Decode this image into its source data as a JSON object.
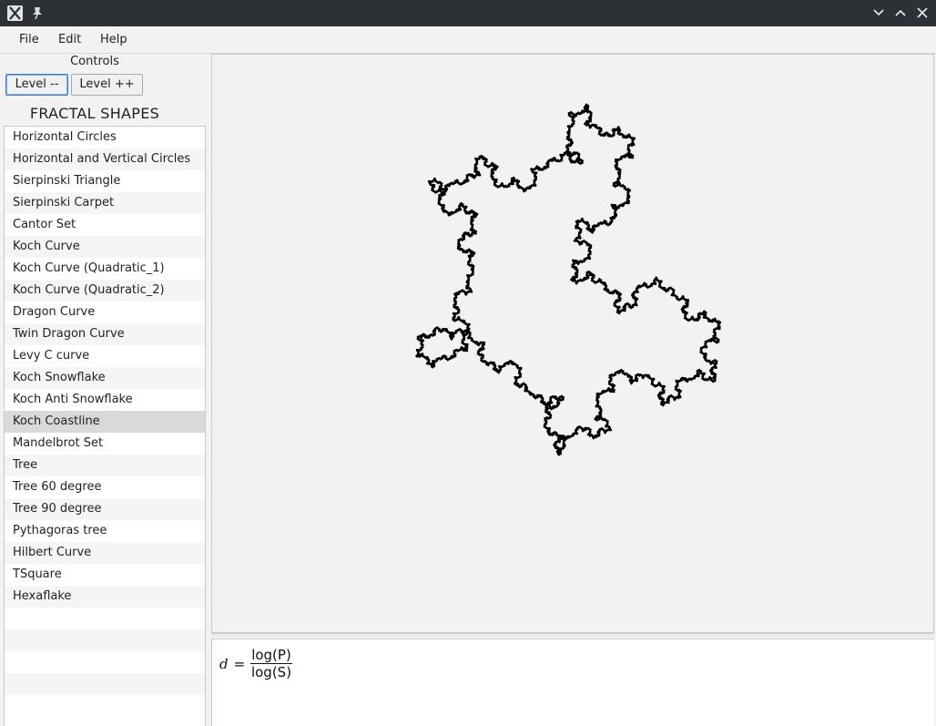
{
  "menu": {
    "file": "File",
    "edit": "Edit",
    "help": "Help"
  },
  "controls": {
    "label": "Controls",
    "level_down": "Level --",
    "level_up": "Level ++",
    "shapes_title": "FRACTAL SHAPES"
  },
  "shapes": [
    "Horizontal Circles",
    "Horizontal and Vertical Circles",
    "Sierpinski Triangle",
    "Sierpinski Carpet",
    "Cantor Set",
    "Koch Curve",
    "Koch Curve (Quadratic_1)",
    "Koch Curve (Quadratic_2)",
    "Dragon Curve",
    "Twin Dragon Curve",
    "Levy C curve",
    "Koch Snowflake",
    "Koch Anti Snowflake",
    "Koch Coastline",
    "Mandelbrot Set",
    "Tree",
    "Tree 60 degree",
    "Tree 90 degree",
    "Pythagoras tree",
    "Hilbert Curve",
    "TSquare",
    "Hexaflake"
  ],
  "selected_shape": "Koch Coastline",
  "formula": {
    "lhs": "d",
    "eq": "=",
    "numerator": "log(P)",
    "denominator": "log(S)"
  },
  "colors": {
    "stroke": "#000000",
    "selection": "#d9d9d9",
    "focus_border": "#3d7fc7"
  },
  "icons": {
    "app": "x-app-icon",
    "pin": "pin-icon",
    "minimize": "chevron-down-icon",
    "maximize": "chevron-up-icon",
    "close": "close-icon"
  }
}
